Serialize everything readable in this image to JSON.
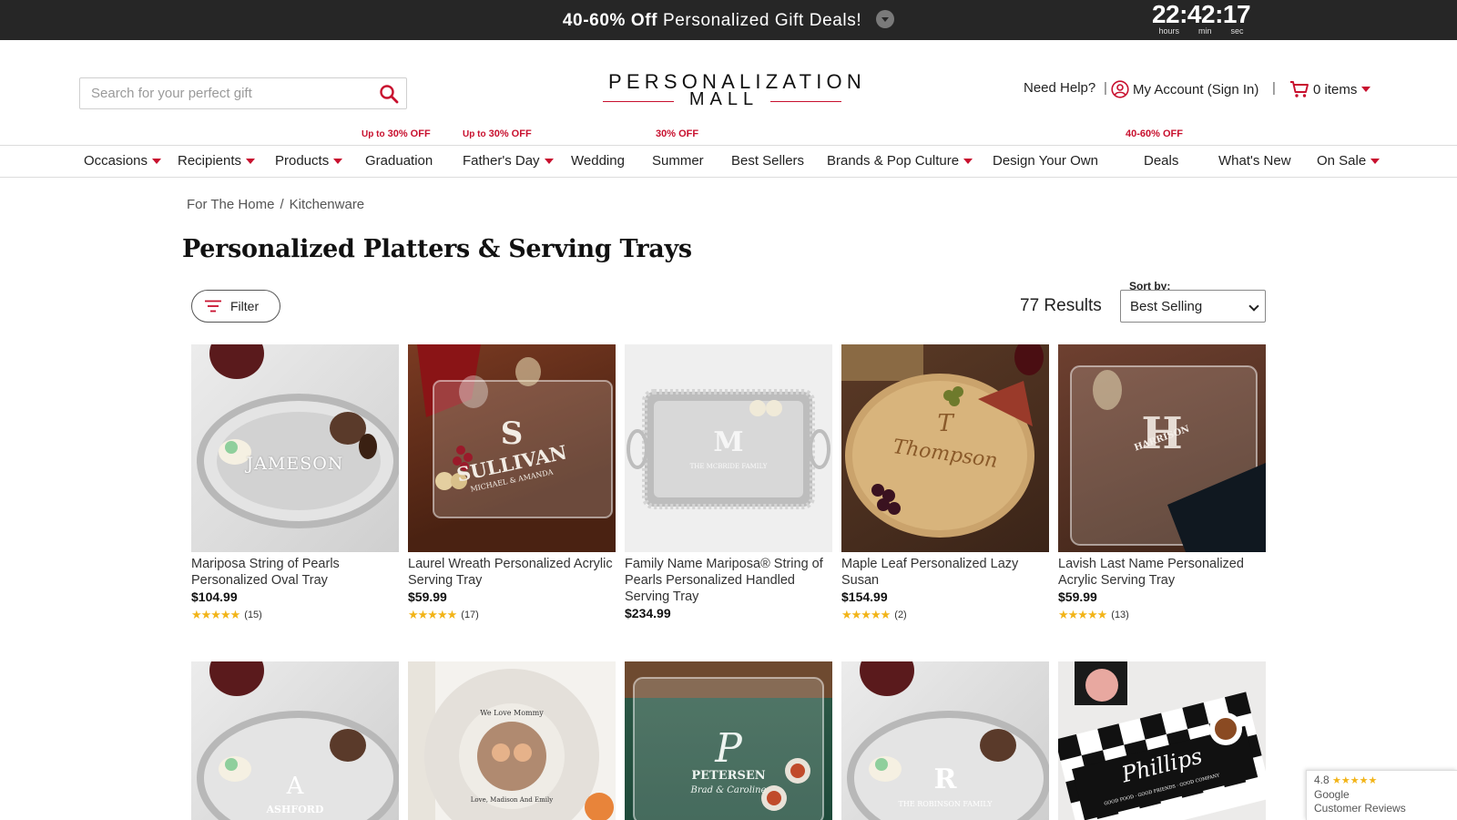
{
  "promo": {
    "bold": "40-60% Off",
    "text": "Personalized Gift Deals!",
    "timer": "22:42:17",
    "labels": [
      "hours",
      "min",
      "sec"
    ]
  },
  "header": {
    "search_placeholder": "Search for your perfect gift",
    "logo_top": "PERSONALIZATION",
    "logo_bottom": "MALL",
    "help": "Need Help?",
    "account": "My Account (Sign In)",
    "cart": "0 items",
    "accent_color": "#c8102e"
  },
  "nav": {
    "tags": {
      "graduation_prefix": "Up to",
      "graduation": "30% OFF",
      "fathers_prefix": "Up to",
      "fathers": "30% OFF",
      "summer": "30% OFF",
      "deals": "40-60% OFF"
    },
    "items": [
      "Occasions",
      "Recipients",
      "Products",
      "Graduation",
      "Father's Day",
      "Wedding",
      "Summer",
      "Best Sellers",
      "Brands & Pop Culture",
      "Design Your Own",
      "Deals",
      "What's New",
      "On Sale"
    ]
  },
  "breadcrumb": [
    "For The Home",
    "Kitchenware"
  ],
  "page_title": "Personalized Platters & Serving Trays",
  "toolbar": {
    "filter": "Filter",
    "results": "77 Results",
    "sort_label": "Sort by:",
    "sort_value": "Best Selling"
  },
  "products": [
    {
      "name": "Mariposa String of Pearls Personalized Oval Tray",
      "price": "$104.99",
      "reviews": "(15)",
      "engrave": "JAMESON"
    },
    {
      "name": "Laurel Wreath Personalized Acrylic Serving Tray",
      "price": "$59.99",
      "reviews": "(17)",
      "engrave": "SULLIVAN",
      "engrave_initial": "S",
      "engrave_sub": "MICHAEL & AMANDA"
    },
    {
      "name": "Family Name Mariposa® String of Pearls Personalized Handled Serving Tray",
      "price": "$234.99",
      "reviews": "",
      "engrave": "M",
      "engrave_sub": "THE MCBRIDE FAMILY"
    },
    {
      "name": "Maple Leaf Personalized Lazy Susan",
      "price": "$154.99",
      "reviews": "(2)",
      "engrave": "Thompson",
      "engrave_initial": "T"
    },
    {
      "name": "Lavish Last Name Personalized Acrylic Serving Tray",
      "price": "$59.99",
      "reviews": "(13)",
      "engrave": "H",
      "engrave_sub": "HARRISON"
    }
  ],
  "products_row2": [
    {
      "engrave": "ASHFORD",
      "engrave_initial": "A"
    },
    {
      "engrave": "We Love Mommy",
      "engrave_sub": "Love, Madison And Emily"
    },
    {
      "engrave": "PETERSEN",
      "engrave_initial": "P",
      "engrave_sub": "Brad & Caroline"
    },
    {
      "engrave": "R",
      "engrave_sub": "THE ROBINSON FAMILY"
    },
    {
      "engrave": "Phillips",
      "engrave_sub": "GOOD FOOD · GOOD FRIENDS · GOOD COMPANY"
    }
  ],
  "google": {
    "score": "4.8",
    "brand": "Google",
    "text": "Customer Reviews"
  }
}
